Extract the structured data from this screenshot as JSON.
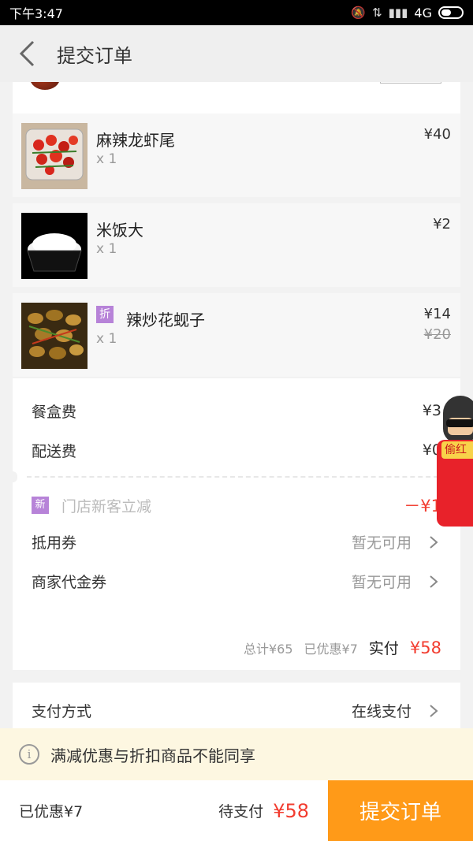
{
  "status_bar": {
    "time": "下午3:47",
    "network": "4G",
    "icons": [
      "mute-icon",
      "data-transfer-icon",
      "signal-icon",
      "battery-icon"
    ]
  },
  "nav": {
    "title": "提交订单",
    "back_icon": "back-chevron-icon"
  },
  "items": [
    {
      "name": "麻辣龙虾尾",
      "qty": "x 1",
      "price": "¥40",
      "image": "spicy-crawfish-tails-photo"
    },
    {
      "name": "米饭大",
      "qty": "x 1",
      "price": "¥2",
      "image": "rice-bowl-photo"
    },
    {
      "name": "辣炒花蚬子",
      "qty": "x 1",
      "price": "¥14",
      "original_price": "¥20",
      "badge": "折",
      "image": "stir-fried-clams-photo"
    }
  ],
  "fees": {
    "box_fee_label": "餐盒费",
    "box_fee": "¥3",
    "delivery_fee_label": "配送费",
    "delivery_fee": "¥0"
  },
  "promos": {
    "new_badge": "新",
    "new_customer_label": "门店新客立减",
    "new_customer_value": "－¥1"
  },
  "coupons": {
    "voucher_label": "抵用券",
    "voucher_value": "暂无可用",
    "merchant_voucher_label": "商家代金券",
    "merchant_voucher_value": "暂无可用"
  },
  "totals": {
    "total": "总计¥65",
    "saved": "已优惠¥7",
    "pay_label": "实付",
    "pay_value": "¥58"
  },
  "payment": {
    "label": "支付方式",
    "value": "在线支付"
  },
  "floating_promo": {
    "tag": "偷红"
  },
  "info_banner": {
    "icon": "i",
    "text": "满减优惠与折扣商品不能同享"
  },
  "bottom_bar": {
    "saved": "已优惠¥7",
    "pending_label": "待支付",
    "pending_value": "¥58",
    "submit_label": "提交订单"
  },
  "colors": {
    "accent_orange": "#ff9a18",
    "price_red": "#f23c2f",
    "badge_purple": "#b783d8",
    "banner_bg": "#fdf7e1"
  }
}
